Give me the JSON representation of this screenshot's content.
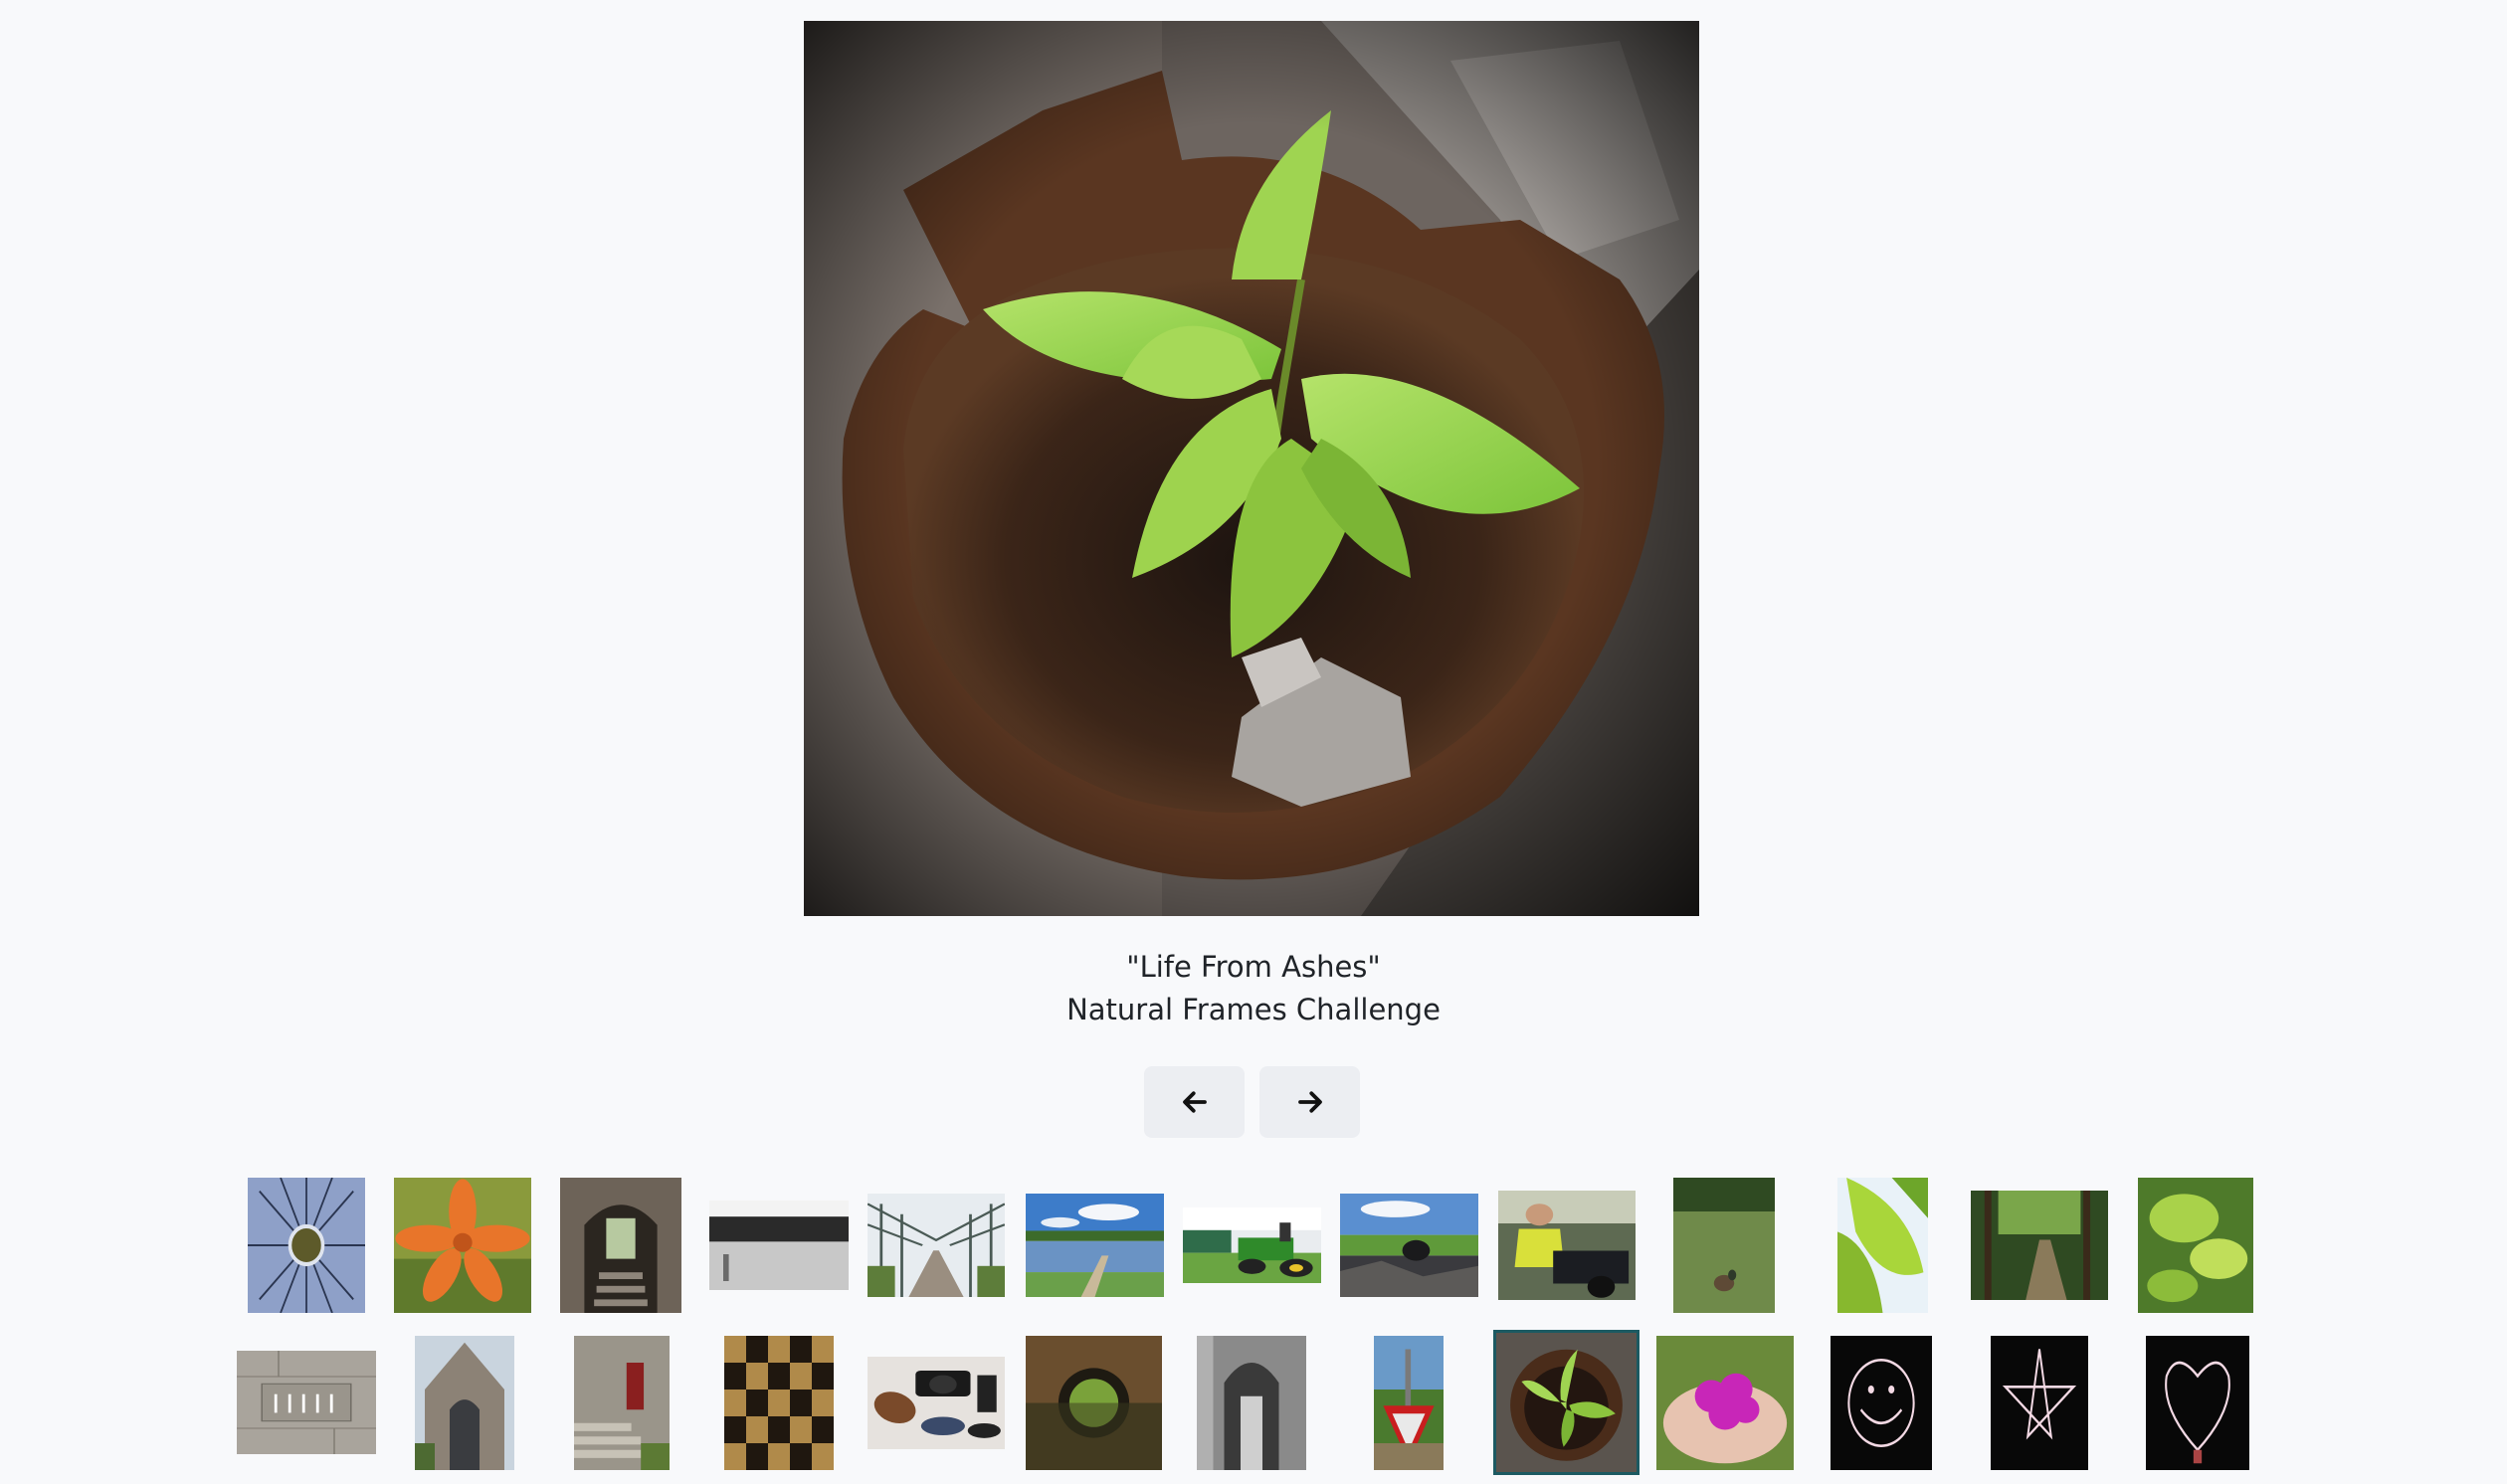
{
  "viewer": {
    "caption_title": "\"Life From Ashes\"",
    "caption_subtitle": "Natural Frames Challenge",
    "prev_icon": "arrow-left-icon",
    "next_icon": "arrow-right-icon"
  },
  "thumbnails": {
    "selected_index": 22,
    "row1": [
      "sun-dial",
      "orange-lily",
      "stone-tunnel-stairs",
      "lake-bw",
      "truss-bridge",
      "lake-dock",
      "lawn-tractor",
      "field-rubble",
      "man-motorcycle",
      "duck-grass",
      "backlit-leaves",
      "forest-path",
      "leaves-sky"
    ],
    "row2": [
      "stone-inscription",
      "stone-church",
      "stone-steps-red-door",
      "checker-pattern",
      "camera-gear",
      "arch-bridge-reflection",
      "bw-archway",
      "yield-sign-post",
      "plant-in-pipe",
      "magenta-flowers",
      "light-smiley",
      "light-star",
      "light-heart"
    ]
  },
  "colors": {
    "accent": "#1c5a62",
    "button_bg": "#eceef2",
    "page_bg": "#f8f9fb"
  }
}
